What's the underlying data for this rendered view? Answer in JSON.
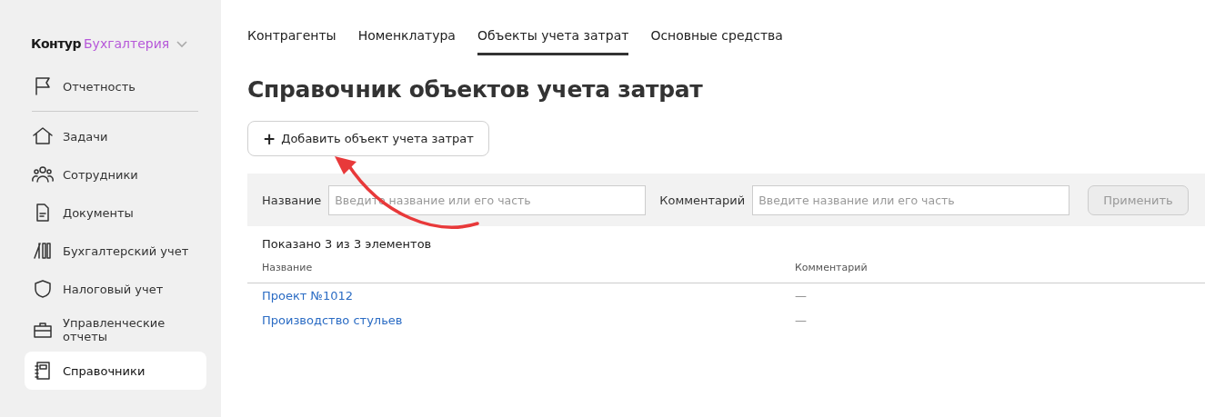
{
  "sidebar": {
    "logo": {
      "brand": "Контур",
      "product": "Бухгалтерия"
    },
    "items": [
      {
        "label": "Отчетность",
        "selected": false
      },
      {
        "label": "Задачи",
        "selected": false
      },
      {
        "label": "Сотрудники",
        "selected": false
      },
      {
        "label": "Документы",
        "selected": false
      },
      {
        "label": "Бухгалтерский учет",
        "selected": false
      },
      {
        "label": "Налоговый учет",
        "selected": false
      },
      {
        "label": "Управленческие отчеты",
        "selected": false
      },
      {
        "label": "Справочники",
        "selected": true
      }
    ]
  },
  "tabs": [
    {
      "label": "Контрагенты",
      "selected": false
    },
    {
      "label": "Номенклатура",
      "selected": false
    },
    {
      "label": "Объекты учета затрат",
      "selected": true
    },
    {
      "label": "Основные средства",
      "selected": false
    }
  ],
  "title": "Справочник объектов учета затрат",
  "add_button": {
    "icon": "+",
    "label": "Добавить объект учета затрат"
  },
  "filter": {
    "fields": [
      {
        "label": "Название",
        "placeholder": "Введите название или его часть"
      },
      {
        "label": "Комментарий",
        "placeholder": "Введите название или его часть"
      }
    ],
    "apply_button": {
      "label": "Применить",
      "disabled": true
    }
  },
  "count": "Показано 3 из 3 элементов",
  "table": {
    "columns": [
      "Название",
      "Комментарий"
    ],
    "rows": [
      {
        "name": "Проект №1012",
        "comment": "—"
      },
      {
        "name": "Производство стульев",
        "comment": "—"
      }
    ]
  }
}
